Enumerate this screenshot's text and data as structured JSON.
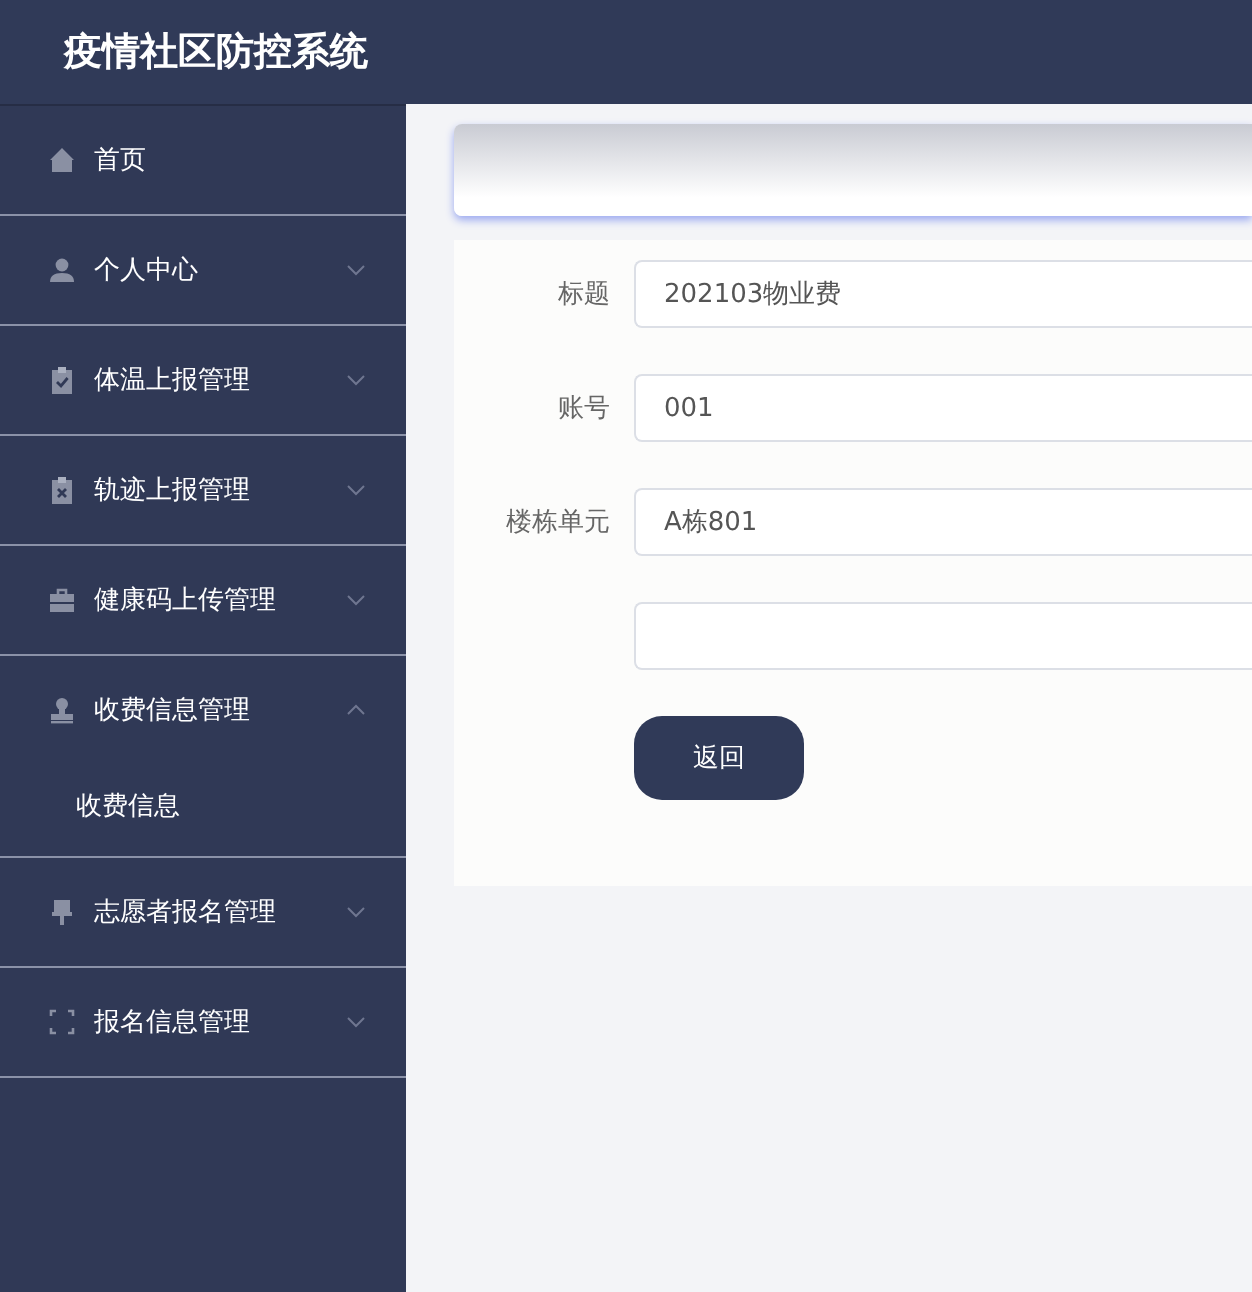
{
  "header": {
    "title": "疫情社区防控系统"
  },
  "sidebar": {
    "items": [
      {
        "kind": "link",
        "label": "首页"
      },
      {
        "kind": "group",
        "label": "个人中心",
        "expanded": false
      },
      {
        "kind": "group",
        "label": "体温上报管理",
        "expanded": false
      },
      {
        "kind": "group",
        "label": "轨迹上报管理",
        "expanded": false
      },
      {
        "kind": "group",
        "label": "健康码上传管理",
        "expanded": false
      },
      {
        "kind": "group",
        "label": "收费信息管理",
        "expanded": true,
        "children": [
          {
            "label": "收费信息"
          }
        ]
      },
      {
        "kind": "group",
        "label": "志愿者报名管理",
        "expanded": false
      },
      {
        "kind": "group",
        "label": "报名信息管理",
        "expanded": false
      }
    ]
  },
  "form": {
    "fields": [
      {
        "kind": "filled",
        "label": "标题",
        "value": "202103物业费"
      },
      {
        "kind": "filled",
        "label": "账号",
        "value": "001"
      },
      {
        "kind": "filled",
        "label": "楼栋单元",
        "value": "A栋801"
      },
      {
        "kind": "blank"
      }
    ],
    "buttons": [
      "返回"
    ]
  }
}
